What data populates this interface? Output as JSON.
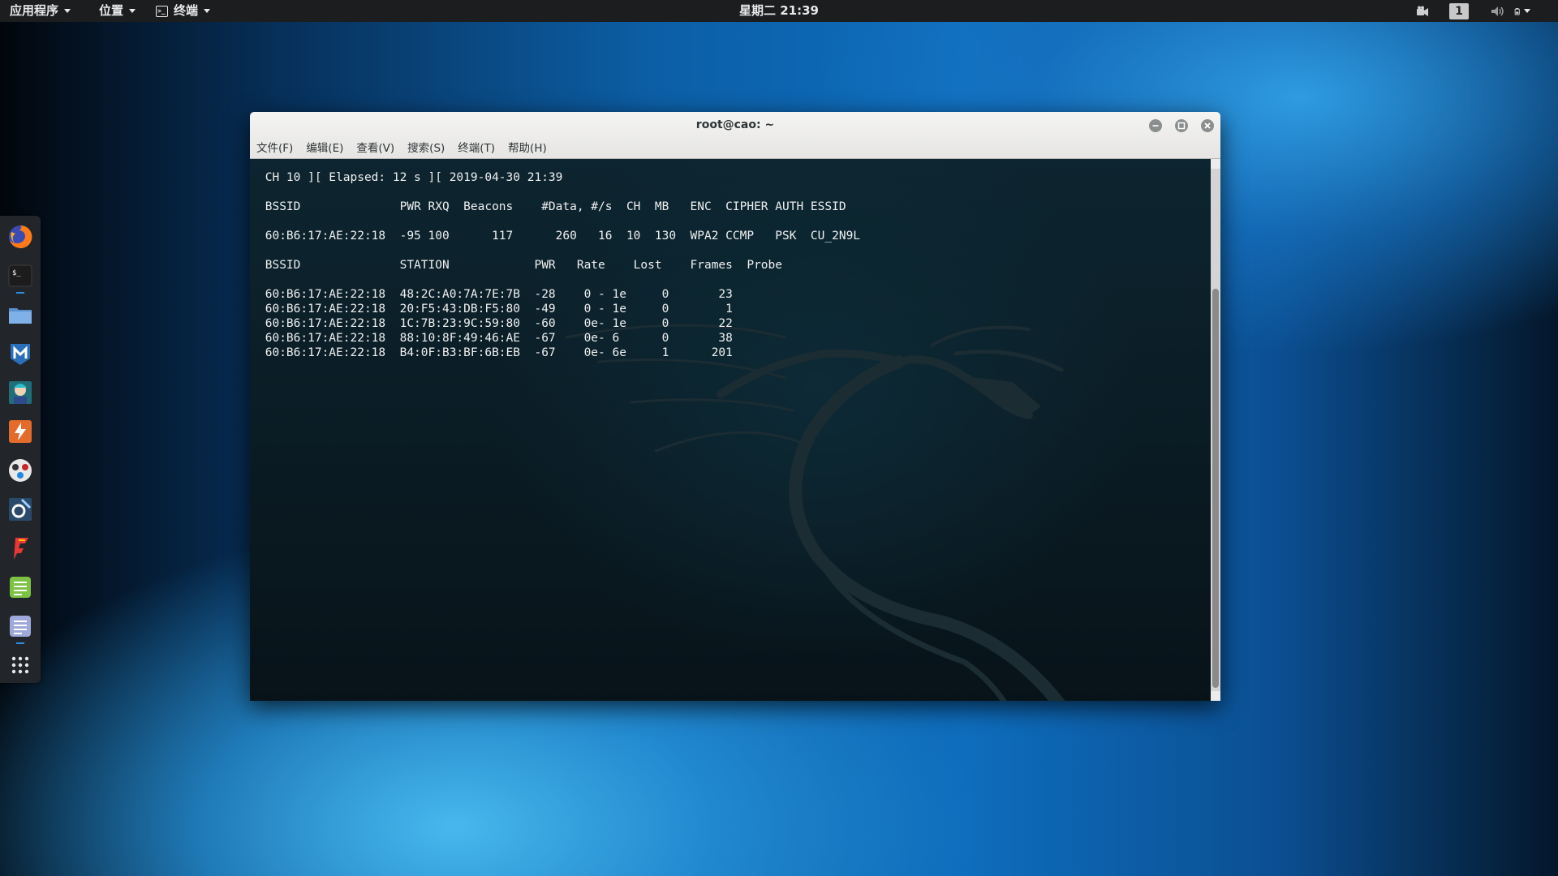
{
  "top_panel": {
    "applications_label": "应用程序",
    "places_label": "位置",
    "terminal_label": "终端",
    "clock": "星期二 21:39",
    "workspace_number": "1"
  },
  "dock": {
    "items": [
      "firefox-icon",
      "terminal-icon",
      "files-icon",
      "metasploit-icon",
      "armitage-icon",
      "burpsuite-icon",
      "maltego-icon",
      "beef-icon",
      "faraday-icon",
      "leafpad-icon",
      "text-editor-icon",
      "show-applications-icon"
    ]
  },
  "window": {
    "title": "root@cao: ~",
    "menu": [
      "文件(F)",
      "编辑(E)",
      "查看(V)",
      "搜索(S)",
      "终端(T)",
      "帮助(H)"
    ]
  },
  "terminal": {
    "lines": [
      " CH 10 ][ Elapsed: 12 s ][ 2019-04-30 21:39",
      "",
      " BSSID              PWR RXQ  Beacons    #Data, #/s  CH  MB   ENC  CIPHER AUTH ESSID",
      "",
      " 60:B6:17:AE:22:18  -95 100      117      260   16  10  130  WPA2 CCMP   PSK  CU_2N9L",
      "",
      " BSSID              STATION            PWR   Rate    Lost    Frames  Probe",
      "",
      " 60:B6:17:AE:22:18  48:2C:A0:7A:7E:7B  -28    0 - 1e     0       23",
      " 60:B6:17:AE:22:18  20:F5:43:DB:F5:80  -49    0 - 1e     0        1",
      " 60:B6:17:AE:22:18  1C:7B:23:9C:59:80  -60    0e- 1e     0       22",
      " 60:B6:17:AE:22:18  88:10:8F:49:46:AE  -67    0e- 6      0       38",
      " 60:B6:17:AE:22:18  B4:0F:B3:BF:6B:EB  -67    0e- 6e     1      201"
    ]
  },
  "colors": {
    "panel_bg": "#1b1d1f",
    "dock_bg": "#22262a",
    "terminal_bg": "#0b1d26",
    "accent": "#2e8ce0"
  }
}
